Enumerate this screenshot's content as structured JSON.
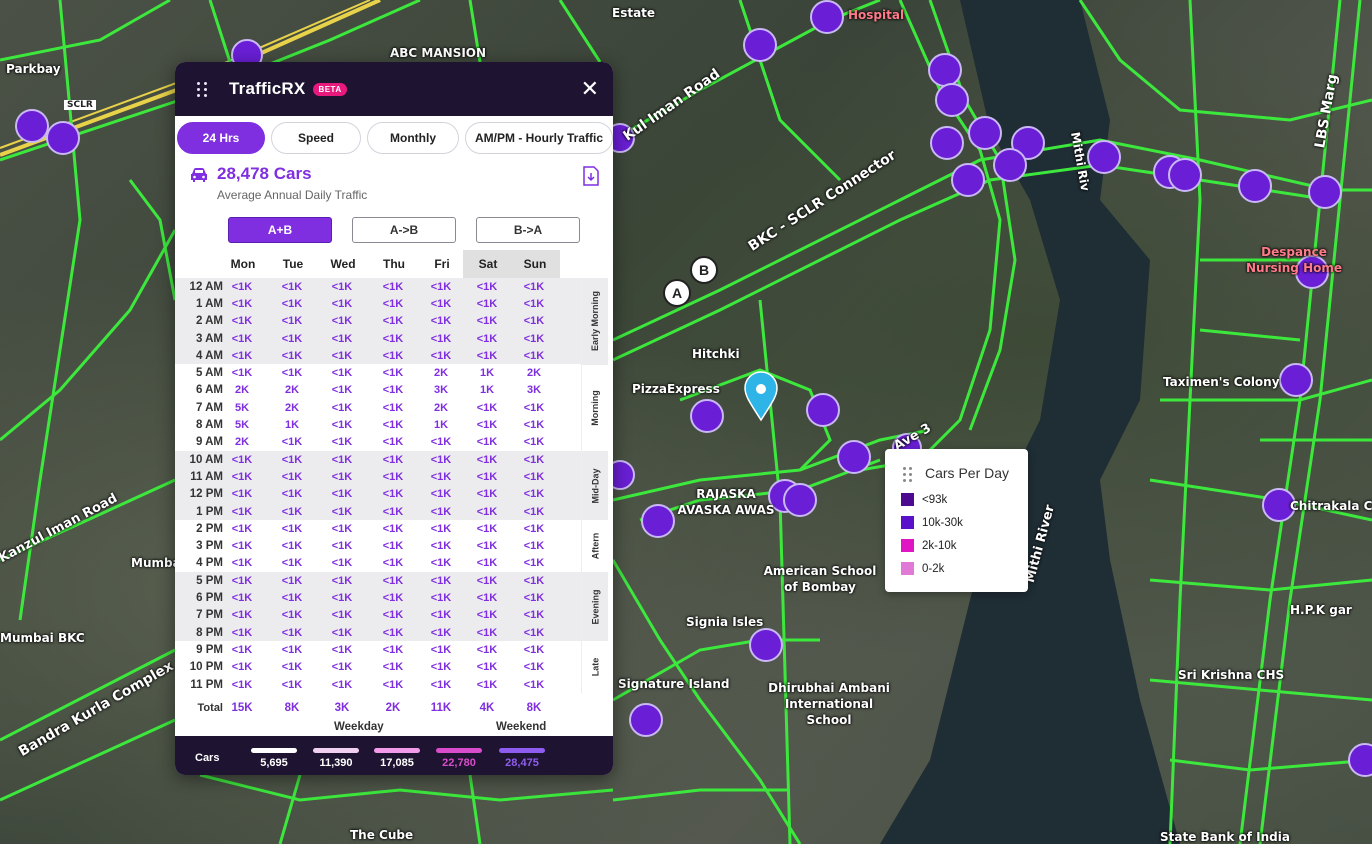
{
  "map": {
    "labels": [
      {
        "text": "Parkbay",
        "pink": false
      },
      {
        "text": "SCLR",
        "pink": false
      },
      {
        "text": "ABC MANSION",
        "pink": false
      },
      {
        "text": "Estate",
        "pink": false
      },
      {
        "text": "Hospital",
        "pink": true
      },
      {
        "text": "Kul Iman Road",
        "pink": false
      },
      {
        "text": "BKC - SCLR Connector",
        "pink": false
      },
      {
        "text": "Mithi Riv",
        "pink": false
      },
      {
        "text": "LBS Marg",
        "pink": false
      },
      {
        "text": "Despance Nursing Home",
        "pink": true
      },
      {
        "text": "Hitchki",
        "pink": false
      },
      {
        "text": "PizzaExpress",
        "pink": false
      },
      {
        "text": "Taximen's Colony",
        "pink": false
      },
      {
        "text": "RAJASKA AVASKA AWAS",
        "pink": false
      },
      {
        "text": "American School of Bombay",
        "pink": false
      },
      {
        "text": "Mithi River",
        "pink": false
      },
      {
        "text": "Kanzul Iman Road",
        "pink": false
      },
      {
        "text": "Mumba",
        "pink": false
      },
      {
        "text": "Mumbai BKC",
        "pink": false
      },
      {
        "text": "Bandra Kurla Complex",
        "pink": false
      },
      {
        "text": "Signia Isles",
        "pink": false
      },
      {
        "text": "Signature Island",
        "pink": false
      },
      {
        "text": "Dhirubhai Ambani International School",
        "pink": false
      },
      {
        "text": "Chitrakala CHS",
        "pink": false
      },
      {
        "text": "H.P.K gar",
        "pink": false
      },
      {
        "text": "Sri Krishna CHS",
        "pink": false
      },
      {
        "text": "The Cube",
        "pink": false
      },
      {
        "text": "State Bank of India",
        "pink": false
      },
      {
        "text": "Ave 3",
        "pink": false
      }
    ],
    "marker_a": "A",
    "marker_b": "B"
  },
  "panel": {
    "title": "TrafficRX",
    "badge": "BETA",
    "tabs": [
      "24 Hrs",
      "Speed",
      "Monthly",
      "AM/PM - Hourly Traffic"
    ],
    "active_tab": "24 Hrs",
    "count": "28,478 Cars",
    "subtitle": "Average Annual Daily Traffic",
    "directions": [
      "A+B",
      "A->B",
      "B->A"
    ],
    "days": [
      "Mon",
      "Tue",
      "Wed",
      "Thu",
      "Fri",
      "Sat",
      "Sun"
    ],
    "hours": [
      {
        "h": "12 AM",
        "v": [
          "<1K",
          "<1K",
          "<1K",
          "<1K",
          "<1K",
          "<1K",
          "<1K"
        ]
      },
      {
        "h": "1 AM",
        "v": [
          "<1K",
          "<1K",
          "<1K",
          "<1K",
          "<1K",
          "<1K",
          "<1K"
        ]
      },
      {
        "h": "2 AM",
        "v": [
          "<1K",
          "<1K",
          "<1K",
          "<1K",
          "<1K",
          "<1K",
          "<1K"
        ]
      },
      {
        "h": "3 AM",
        "v": [
          "<1K",
          "<1K",
          "<1K",
          "<1K",
          "<1K",
          "<1K",
          "<1K"
        ]
      },
      {
        "h": "4 AM",
        "v": [
          "<1K",
          "<1K",
          "<1K",
          "<1K",
          "<1K",
          "<1K",
          "<1K"
        ]
      },
      {
        "h": "5 AM",
        "v": [
          "<1K",
          "<1K",
          "<1K",
          "<1K",
          "2K",
          "1K",
          "2K"
        ]
      },
      {
        "h": "6 AM",
        "v": [
          "2K",
          "2K",
          "<1K",
          "<1K",
          "3K",
          "1K",
          "3K"
        ]
      },
      {
        "h": "7 AM",
        "v": [
          "5K",
          "2K",
          "<1K",
          "<1K",
          "2K",
          "<1K",
          "<1K"
        ]
      },
      {
        "h": "8 AM",
        "v": [
          "5K",
          "1K",
          "<1K",
          "<1K",
          "1K",
          "<1K",
          "<1K"
        ]
      },
      {
        "h": "9 AM",
        "v": [
          "2K",
          "<1K",
          "<1K",
          "<1K",
          "<1K",
          "<1K",
          "<1K"
        ]
      },
      {
        "h": "10 AM",
        "v": [
          "<1K",
          "<1K",
          "<1K",
          "<1K",
          "<1K",
          "<1K",
          "<1K"
        ]
      },
      {
        "h": "11 AM",
        "v": [
          "<1K",
          "<1K",
          "<1K",
          "<1K",
          "<1K",
          "<1K",
          "<1K"
        ]
      },
      {
        "h": "12 PM",
        "v": [
          "<1K",
          "<1K",
          "<1K",
          "<1K",
          "<1K",
          "<1K",
          "<1K"
        ]
      },
      {
        "h": "1 PM",
        "v": [
          "<1K",
          "<1K",
          "<1K",
          "<1K",
          "<1K",
          "<1K",
          "<1K"
        ]
      },
      {
        "h": "2 PM",
        "v": [
          "<1K",
          "<1K",
          "<1K",
          "<1K",
          "<1K",
          "<1K",
          "<1K"
        ]
      },
      {
        "h": "3 PM",
        "v": [
          "<1K",
          "<1K",
          "<1K",
          "<1K",
          "<1K",
          "<1K",
          "<1K"
        ]
      },
      {
        "h": "4 PM",
        "v": [
          "<1K",
          "<1K",
          "<1K",
          "<1K",
          "<1K",
          "<1K",
          "<1K"
        ]
      },
      {
        "h": "5 PM",
        "v": [
          "<1K",
          "<1K",
          "<1K",
          "<1K",
          "<1K",
          "<1K",
          "<1K"
        ]
      },
      {
        "h": "6 PM",
        "v": [
          "<1K",
          "<1K",
          "<1K",
          "<1K",
          "<1K",
          "<1K",
          "<1K"
        ]
      },
      {
        "h": "7 PM",
        "v": [
          "<1K",
          "<1K",
          "<1K",
          "<1K",
          "<1K",
          "<1K",
          "<1K"
        ]
      },
      {
        "h": "8 PM",
        "v": [
          "<1K",
          "<1K",
          "<1K",
          "<1K",
          "<1K",
          "<1K",
          "<1K"
        ]
      },
      {
        "h": "9 PM",
        "v": [
          "<1K",
          "<1K",
          "<1K",
          "<1K",
          "<1K",
          "<1K",
          "<1K"
        ]
      },
      {
        "h": "10 PM",
        "v": [
          "<1K",
          "<1K",
          "<1K",
          "<1K",
          "<1K",
          "<1K",
          "<1K"
        ]
      },
      {
        "h": "11 PM",
        "v": [
          "<1K",
          "<1K",
          "<1K",
          "<1K",
          "<1K",
          "<1K",
          "<1K"
        ]
      }
    ],
    "periods": [
      "Early Morning",
      "Morning",
      "Mid-Day",
      "Aftern",
      "Evening",
      "Late"
    ],
    "total_label": "Total",
    "totals": [
      "15K",
      "8K",
      "3K",
      "2K",
      "11K",
      "4K",
      "8K"
    ],
    "weekday_label": "Weekday",
    "weekend_label": "Weekend",
    "footer_label": "Cars",
    "footer_legend": [
      {
        "value": "5,695",
        "color": "#ffffff"
      },
      {
        "value": "11,390",
        "color": "#f1cff0"
      },
      {
        "value": "17,085",
        "color": "#f19bea"
      },
      {
        "value": "22,780",
        "color": "#d94ccb"
      },
      {
        "value": "28,475",
        "color": "#8f5cf0"
      }
    ]
  },
  "legend": {
    "title": "Cars Per Day",
    "items": [
      {
        "label": "<93k",
        "color": "#4b0a8f"
      },
      {
        "label": "10k-30k",
        "color": "#5b10c9"
      },
      {
        "label": "2k-10k",
        "color": "#e015c4"
      },
      {
        "label": "0-2k",
        "color": "#e07ad6"
      }
    ]
  }
}
